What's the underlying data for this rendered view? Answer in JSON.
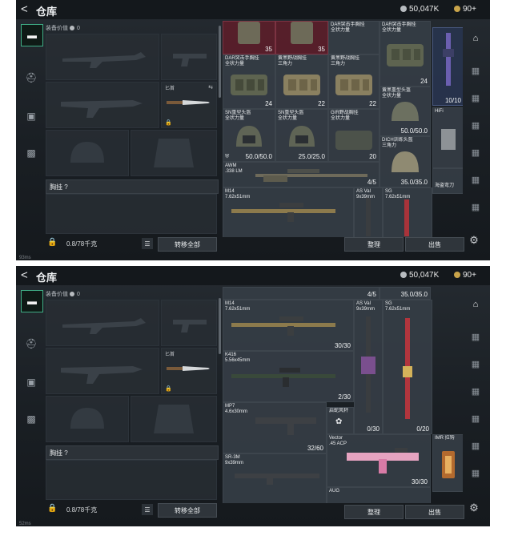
{
  "app": {
    "title": "仓库",
    "back": "<",
    "currency": "50,047K",
    "gold": "90+",
    "status": "93ms",
    "status2": "52ms"
  },
  "tabs": [
    {
      "icon": "pistol-icon",
      "glyph": "▬",
      "active": true
    },
    {
      "icon": "helmet-icon",
      "glyph": "⛑",
      "active": false
    },
    {
      "icon": "vest-icon",
      "glyph": "▣",
      "active": false
    },
    {
      "icon": "backpack-icon",
      "glyph": "▩",
      "active": false
    }
  ],
  "equipment": {
    "value_label": "装备价值",
    "value": "0",
    "chest_label": "胸挂 ?",
    "weight": "0.8/78千克",
    "transfer_all": "转移全部",
    "knife_label": "匕首"
  },
  "actions": {
    "organize": "整理",
    "sell": "出售"
  },
  "screen1_items": [
    {
      "name": "",
      "count": "35",
      "style": "red"
    },
    {
      "name": "",
      "count": "35",
      "style": "red"
    },
    {
      "name": "DAR突击手胸挂\n全状力量",
      "count": "24",
      "style": ""
    },
    {
      "name": "DAR突击手胸挂\n全状力量",
      "count": "24",
      "style": ""
    },
    {
      "name": "黄黑野战胸挂\n三角力",
      "count": "22",
      "style": ""
    },
    {
      "name": "黄黑野战胸挂\n三角力",
      "count": "22",
      "style": ""
    },
    {
      "name": "SN重型头盔\n全状力量",
      "count": "50.0/50.0",
      "style": ""
    },
    {
      "name": "SN重型头盔\n全状力量",
      "count": "25.0/25.0",
      "style": ""
    },
    {
      "name": "GIR野战胸挂\n全状力量",
      "count": "20",
      "style": ""
    },
    {
      "name": "黄黑重型头盔\n全状力量",
      "count": "50.0/50.0",
      "style": ""
    },
    {
      "name": "DICH训练头盔\n三角力",
      "count": "35.0/35.0",
      "style": ""
    },
    {
      "name": "HiFi",
      "count": "10/10",
      "style": "blue"
    },
    {
      "name": "AWM\n.338 LM",
      "count": "4/5",
      "style": ""
    },
    {
      "name": "M14\n7.62x51mm",
      "count": "",
      "style": ""
    },
    {
      "name": "AS Val\n9x39mm",
      "count": "",
      "style": ""
    },
    {
      "name": "SG\n7.62x51mm",
      "count": "",
      "style": ""
    },
    {
      "name": "海盗弯刀",
      "count": "",
      "style": ""
    }
  ],
  "screen2_items": [
    {
      "name": "M14\n7.62x51mm",
      "count": "30/30",
      "style": ""
    },
    {
      "name": "K416\n5.56x45mm",
      "count": "2/30",
      "style": ""
    },
    {
      "name": "MP7\n4.6x30mm",
      "count": "32/60",
      "style": ""
    },
    {
      "name": "SR-3M\n9x39mm",
      "count": "",
      "style": ""
    },
    {
      "name": "AS Val\n9x39mm",
      "count": "0/30",
      "style": ""
    },
    {
      "name": "SG\n7.62x51mm",
      "count": "0/20",
      "style": ""
    },
    {
      "name": "Vector\n.45 ACP",
      "count": "30/30",
      "style": ""
    },
    {
      "name": "启蛇风轩",
      "count": "",
      "style": ""
    },
    {
      "name": "IMR 拉钩",
      "count": "",
      "style": ""
    },
    {
      "name": "AUG",
      "count": "",
      "style": ""
    },
    {
      "name": "4/5",
      "count": "",
      "style": ""
    },
    {
      "name": "35.0/35.0",
      "count": "",
      "style": ""
    }
  ]
}
